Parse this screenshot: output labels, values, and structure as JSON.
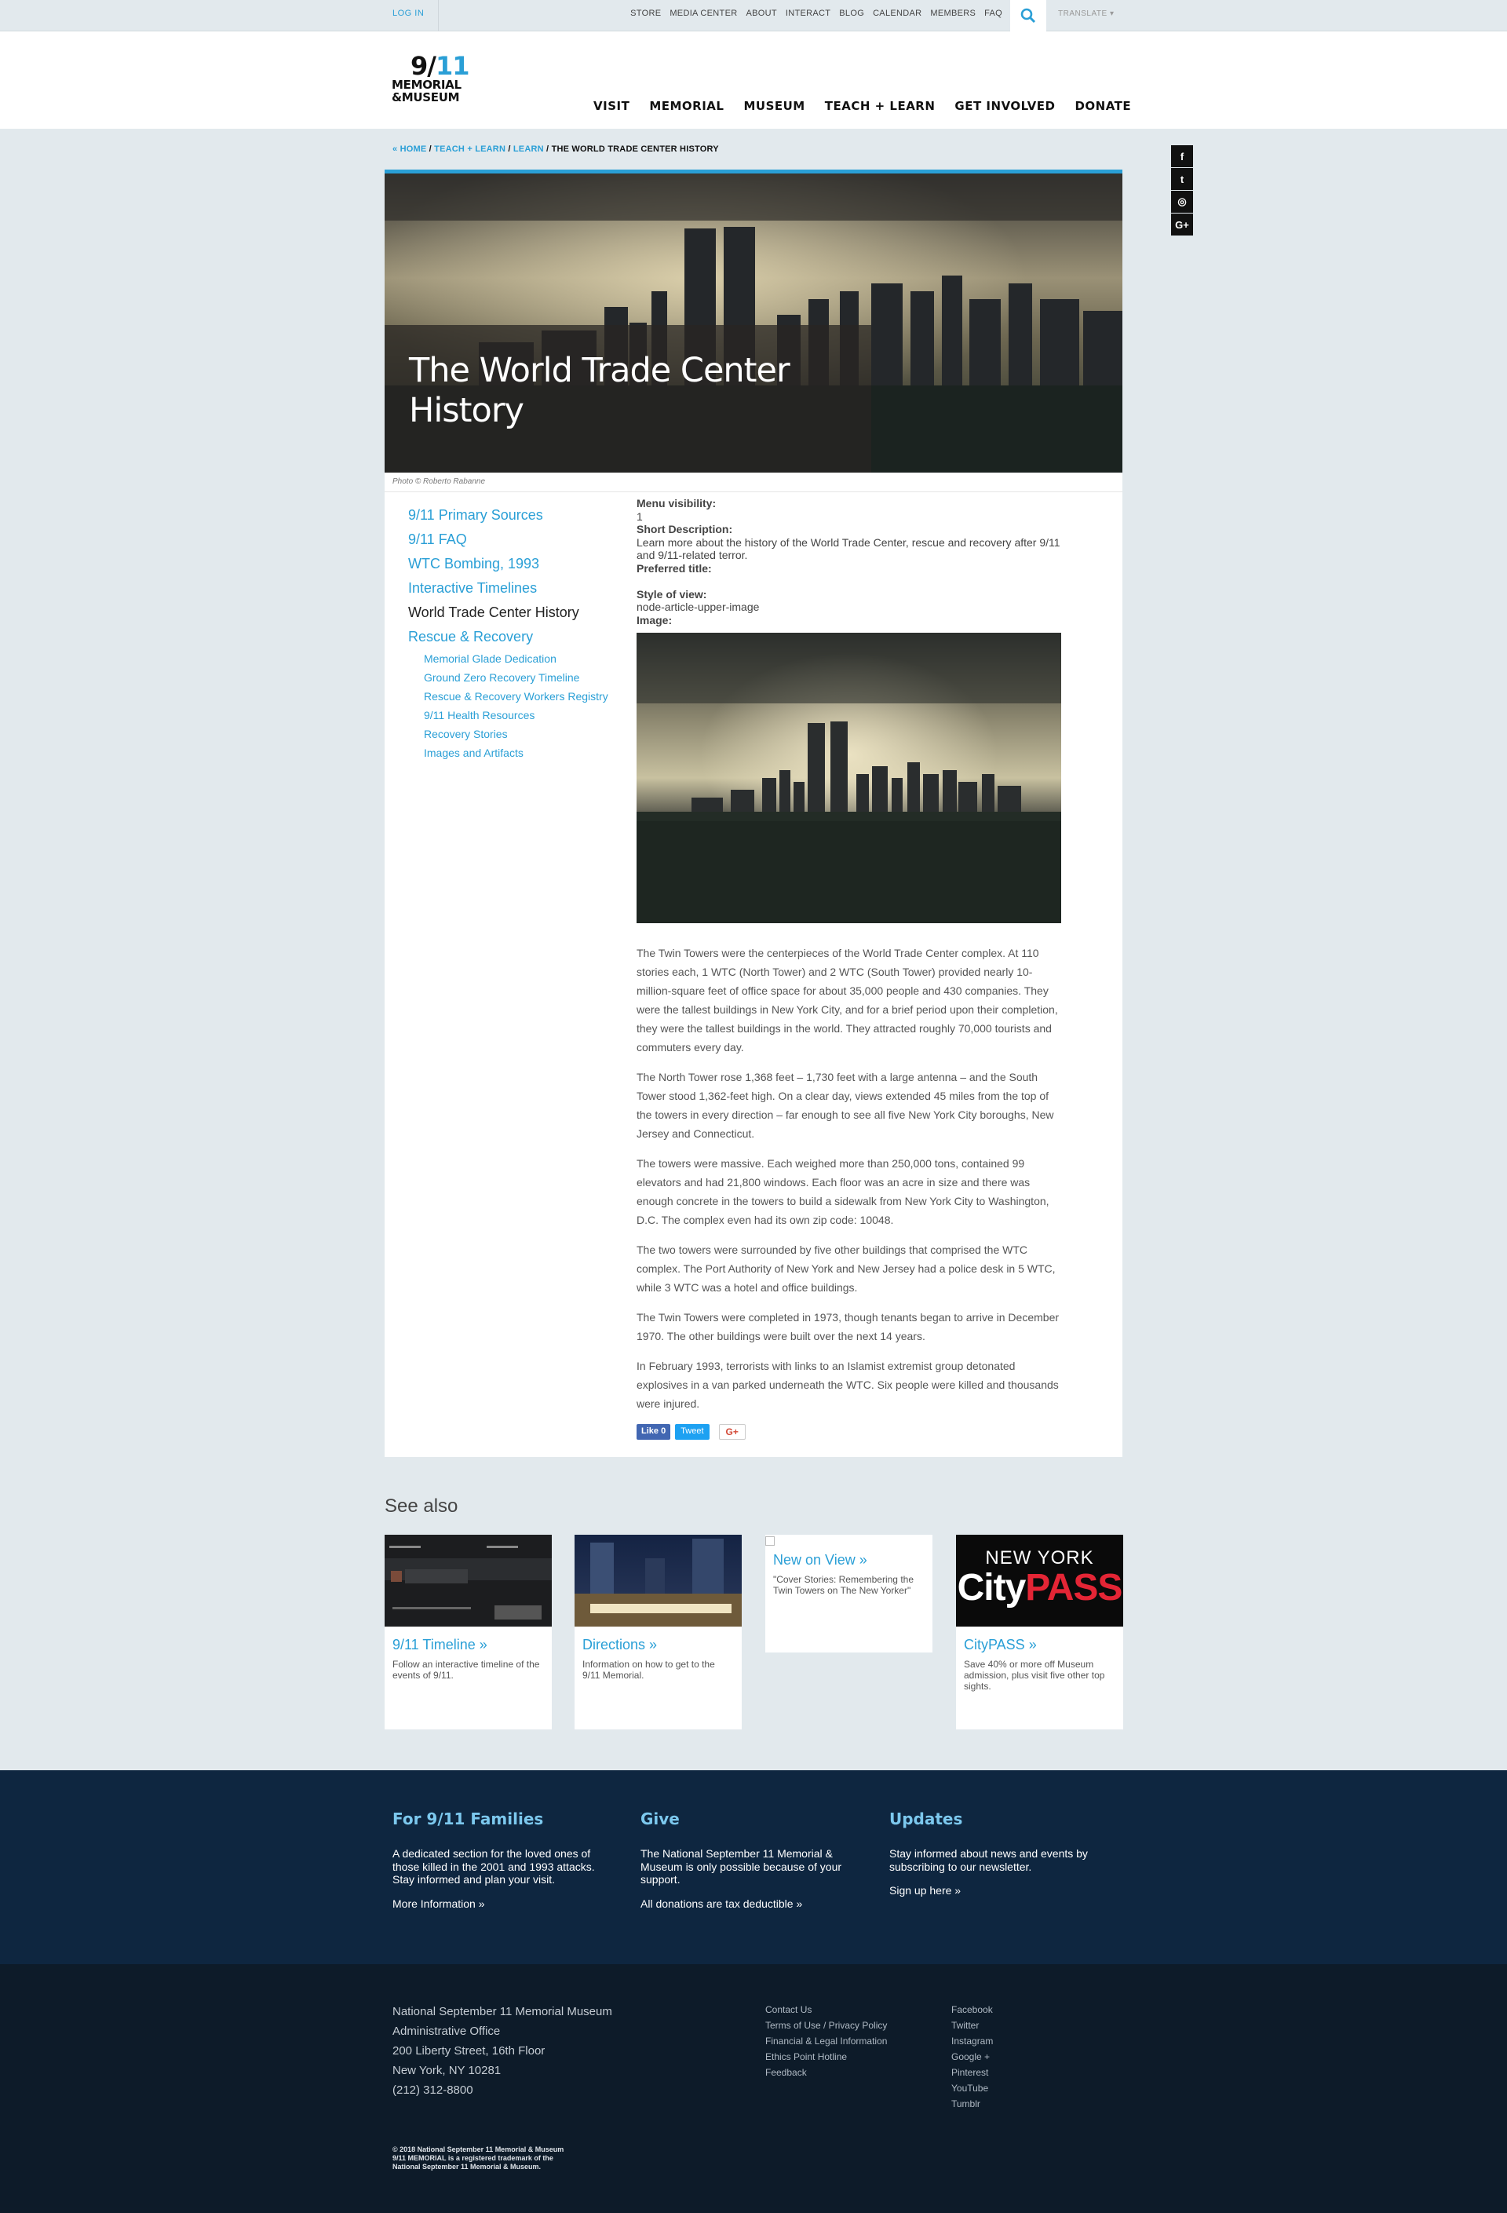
{
  "topbar": {
    "login": "LOG IN",
    "links": [
      "STORE",
      "MEDIA CENTER",
      "ABOUT",
      "INTERACT",
      "BLOG",
      "CALENDAR",
      "MEMBERS",
      "FAQ"
    ],
    "translate": "TRANSLATE ▾"
  },
  "header": {
    "logo_num_a": "9/",
    "logo_num_b": "11",
    "logo_line1": "MEMORIAL",
    "logo_line2": "&MUSEUM",
    "nav": [
      "VISIT",
      "MEMORIAL",
      "MUSEUM",
      "TEACH + LEARN",
      "GET INVOLVED",
      "DONATE"
    ]
  },
  "breadcrumb": {
    "home": "« HOME",
    "teach": "TEACH + LEARN",
    "learn": "LEARN",
    "sep": "/",
    "current": "THE WORLD TRADE CENTER HISTORY"
  },
  "social_side": [
    "f",
    "t",
    "◎",
    "G+"
  ],
  "hero": {
    "title": "The World Trade Center History",
    "credit": "Photo © Roberto Rabanne"
  },
  "sidemenu": {
    "items": [
      "9/11 Primary Sources",
      "9/11 FAQ",
      "WTC Bombing, 1993",
      "Interactive Timelines",
      "World Trade Center History",
      "Rescue & Recovery"
    ],
    "subitems": [
      "Memorial Glade Dedication",
      "Ground Zero Recovery Timeline",
      "Rescue & Recovery Workers Registry",
      "9/11 Health Resources",
      "Recovery Stories",
      "Images and Artifacts"
    ]
  },
  "meta": {
    "menu_visibility_label": "Menu visibility:",
    "menu_visibility_value": "1",
    "short_description_label": "Short Description:",
    "short_description_value": "Learn more about the history of the World Trade Center, rescue and recovery after 9/11 and 9/11-related terror.",
    "preferred_title_label": "Preferred title:",
    "style_of_view_label": "Style of view:",
    "style_of_view_value": "node-article-upper-image",
    "image_label": "Image:"
  },
  "body": [
    "The Twin Towers were the centerpieces of the World Trade Center complex. At 110 stories each, 1 WTC (North Tower) and 2 WTC (South Tower) provided nearly 10-million-square feet of office space for about 35,000 people and 430 companies. They were the tallest buildings in New York City, and for a brief period upon their completion, they were the tallest buildings in the world. They attracted roughly 70,000 tourists and commuters every day.",
    "The North Tower rose 1,368 feet – 1,730 feet with a large antenna – and the South Tower stood 1,362-feet high. On a clear day, views extended 45 miles from the top of the towers in every direction – far enough to see all five New York City boroughs, New Jersey and Connecticut.",
    "The towers were massive. Each weighed more than 250,000 tons, contained 99 elevators and had 21,800 windows. Each floor was an acre in size and there was enough concrete in the towers to build a sidewalk from New York City to Washington, D.C. The complex even had its own zip code: 10048.",
    "The two towers were surrounded by five other buildings that comprised the WTC complex. The Port Authority of New York and New Jersey had a police desk in 5 WTC, while 3 WTC was a hotel and office buildings.",
    "The Twin Towers were completed in 1973, though tenants began to arrive in December 1970. The other buildings were built over the next 14 years.",
    "In February 1993, terrorists with links to an Islamist extremist group detonated explosives in a van parked underneath the WTC. Six people were killed and thousands were injured."
  ],
  "share": {
    "like": "Like 0",
    "tweet": "Tweet",
    "gplus": "G+"
  },
  "see_also": {
    "title": "See also",
    "cards": [
      {
        "title": "9/11 Timeline »",
        "desc": "Follow an interactive timeline of the events of 9/11."
      },
      {
        "title": "Directions »",
        "desc": "Information on how to get to the 9/11 Memorial."
      },
      {
        "title": "New on View »",
        "desc": "\"Cover Stories: Remembering the Twin Towers on The New Yorker\""
      },
      {
        "title": "CityPASS »",
        "desc": "Save 40% or more off Museum admission, plus visit five other top sights."
      }
    ],
    "citypass_line1": "NEW YORK",
    "citypass_city": "City",
    "citypass_pass": "PASS"
  },
  "band": {
    "families": {
      "title": "For 9/11 Families",
      "text": "A dedicated section for the loved ones of those killed in the 2001 and 1993 attacks. Stay informed and plan your visit.",
      "link": "More Information »"
    },
    "give": {
      "title": "Give",
      "text": "The National September 11 Memorial & Museum is only possible because of your support.",
      "link": "All donations are tax deductible »"
    },
    "updates": {
      "title": "Updates",
      "text": "Stay informed about news and events by subscribing to our newsletter.",
      "link": "Sign up here »"
    }
  },
  "footer": {
    "address": [
      "National September 11 Memorial Museum",
      "Administrative Office",
      "200 Liberty Street, 16th Floor",
      "New York, NY 10281",
      "(212) 312-8800"
    ],
    "links": [
      "Contact Us",
      "Terms of Use / Privacy Policy",
      "Financial & Legal Information",
      "Ethics Point Hotline",
      "Feedback"
    ],
    "social": [
      "Facebook",
      "Twitter",
      "Instagram",
      "Google +",
      "Pinterest",
      "YouTube",
      "Tumblr"
    ],
    "copyright": [
      "© 2018 National September 11 Memorial & Museum",
      "9/11 MEMORIAL is a registered trademark of the",
      "National September 11 Memorial & Museum."
    ]
  },
  "colors": {
    "accent": "#2a9fd6",
    "band": "#0e2640",
    "footer": "#0d1b29",
    "page_bg": "#e2e9ed"
  },
  "icons": [
    "search-icon",
    "facebook-icon",
    "twitter-icon",
    "instagram-icon",
    "google-plus-icon"
  ]
}
